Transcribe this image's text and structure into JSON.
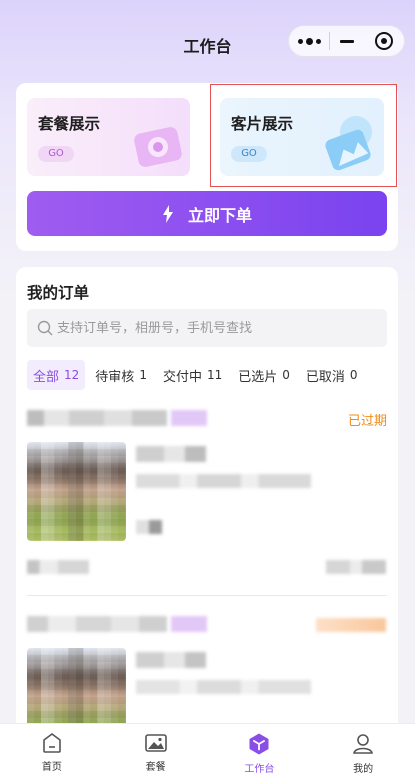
{
  "header": {
    "title": "工作台",
    "capsule": {
      "more_icon": "more-dots-icon",
      "minimize_icon": "minus-icon",
      "close_icon": "target-circle-icon"
    }
  },
  "promo": {
    "package": {
      "title": "套餐展示",
      "go": "GO",
      "icon": "camera-icon"
    },
    "sample": {
      "title": "客片展示",
      "go": "GO",
      "icon": "photo-icon"
    },
    "order_now": {
      "label": "立即下单",
      "icon": "lightning-icon"
    }
  },
  "orders": {
    "title": "我的订单",
    "search": {
      "placeholder": "支持订单号，相册号，手机号查找",
      "value": ""
    },
    "tabs": [
      {
        "label": "全部",
        "count": "12",
        "active": true
      },
      {
        "label": "待审核",
        "count": "1"
      },
      {
        "label": "交付中",
        "count": "11"
      },
      {
        "label": "已选片",
        "count": "0"
      },
      {
        "label": "已取消",
        "count": "0"
      }
    ],
    "items": [
      {
        "status": "已过期"
      }
    ]
  },
  "tabbar": {
    "items": [
      {
        "label": "首页",
        "icon": "home-icon"
      },
      {
        "label": "套餐",
        "icon": "image-icon"
      },
      {
        "label": "工作台",
        "icon": "cube-icon",
        "active": true
      },
      {
        "label": "我的",
        "icon": "user-icon"
      }
    ]
  },
  "colors": {
    "accent": "#8a4ee6",
    "expired": "#f08c1a",
    "highlight": "#e35252"
  }
}
